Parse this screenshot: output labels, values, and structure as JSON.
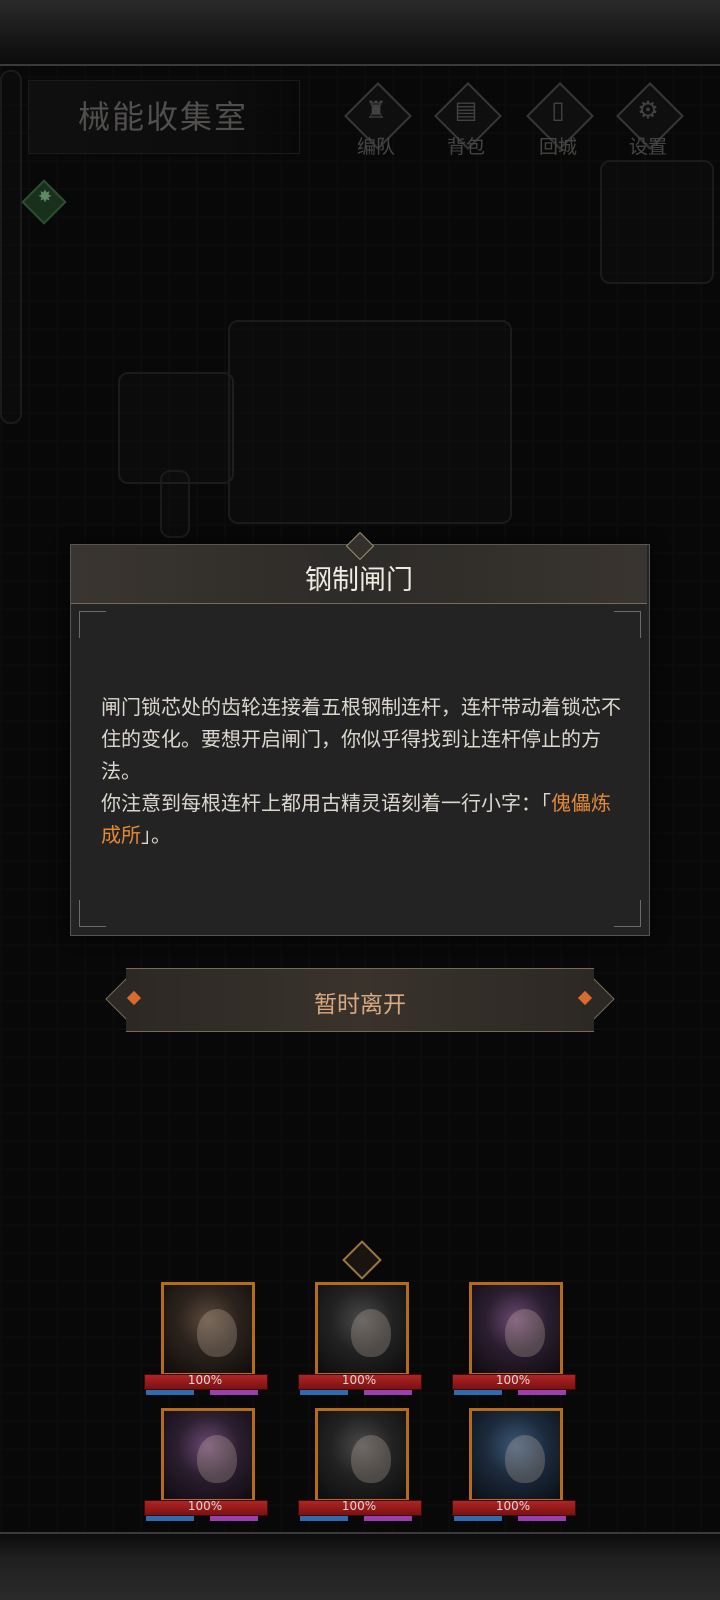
{
  "location": {
    "room_name": "械能收集室"
  },
  "top_menu": [
    {
      "label": "编队",
      "icon": "helmet-icon"
    },
    {
      "label": "背包",
      "icon": "backpack-icon"
    },
    {
      "label": "回城",
      "icon": "door-icon"
    },
    {
      "label": "设置",
      "icon": "gear-icon"
    }
  ],
  "dialog": {
    "title": "钢制闸门",
    "paragraph1": "闸门锁芯处的齿轮连接着五根钢制连杆，连杆带动着锁芯不住的变化。要想开启闸门，你似乎得找到让连杆停止的方法。",
    "paragraph2_prefix": "你注意到每根连杆上都用古精灵语刻着一行小字：「",
    "paragraph2_highlight": "傀儡炼成所",
    "paragraph2_suffix": "」。",
    "leave_button": "暂时离开"
  },
  "party": [
    {
      "hp": "100%",
      "portrait": "silver-haired-woman"
    },
    {
      "hp": "100%",
      "portrait": "armored-beast"
    },
    {
      "hp": "100%",
      "portrait": "crowned-elf"
    },
    {
      "hp": "100%",
      "portrait": "masked-demon"
    },
    {
      "hp": "100%",
      "portrait": "wolf-beast"
    },
    {
      "hp": "100%",
      "portrait": "blue-aura-man"
    }
  ],
  "colors": {
    "highlight": "#e3893a",
    "portrait_frame": "#b46c1c",
    "hp": "#b02424",
    "mp": "#2f6bb0",
    "sp": "#9b3fb0"
  }
}
